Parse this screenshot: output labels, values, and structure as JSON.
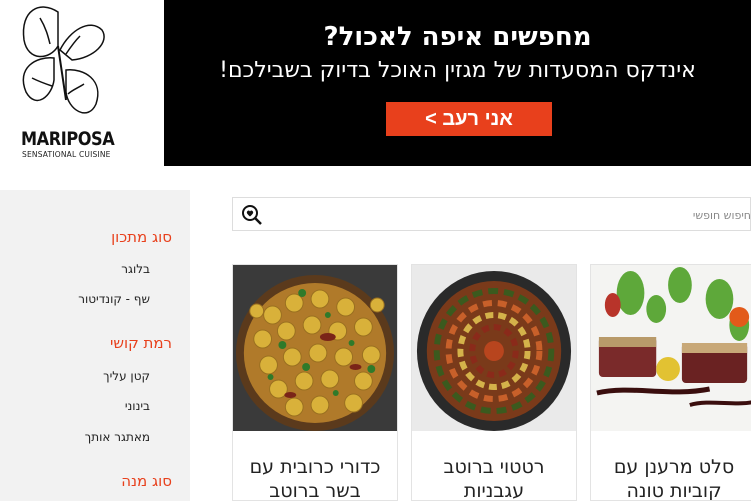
{
  "logo": {
    "name": "MARIPOSA",
    "tagline": "SENSATIONAL CUISINE"
  },
  "banner": {
    "title": "מחפשים איפה לאכול?",
    "subtitle": "אינדקס המסעדות של מגזין האוכל בדיוק בשבילכם!",
    "button_label": "אני רעב >"
  },
  "sidebar": {
    "sections": [
      {
        "heading": "סוג מתכון",
        "items": [
          "בלוגר",
          "שף - קונדיטור"
        ]
      },
      {
        "heading": "רמת קושי",
        "items": [
          "קטן עליך",
          "בינוני",
          "מאתגר אותך"
        ]
      },
      {
        "heading": "סוג מנה",
        "items": []
      }
    ]
  },
  "search": {
    "placeholder": "חיפוש חופשי",
    "icon": "search-heart-icon"
  },
  "cards": [
    {
      "title_line1": "סלט מרענן עם",
      "title_line2": "קוביות טונה"
    },
    {
      "title_line1": "רטטוי ברוטב",
      "title_line2": "עגבניות"
    },
    {
      "title_line1": "כדורי כרובית עם",
      "title_line2": "בשר ברוטב"
    }
  ],
  "colors": {
    "accent": "#e8401c",
    "banner_bg": "#000000",
    "sidebar_bg": "#f2f2f2"
  }
}
